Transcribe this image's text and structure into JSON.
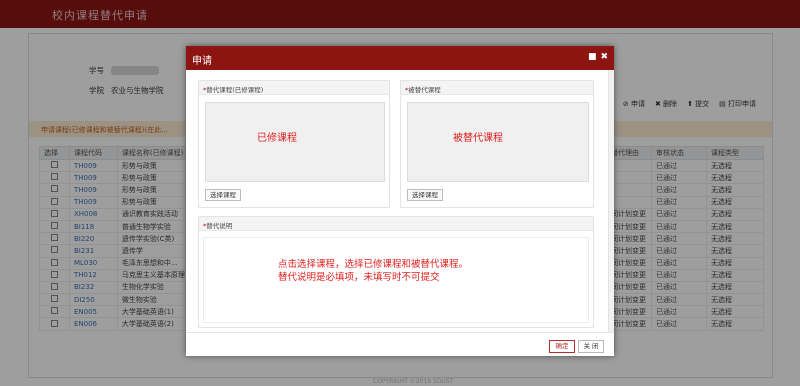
{
  "app": {
    "title": "校内课程替代申请"
  },
  "info": {
    "student_id_label": "学号",
    "college_label": "学院",
    "college_value": "农业与生物学院"
  },
  "toolbar": {
    "apply": "⊘ 申请",
    "delete": "✖ 删除",
    "submit": "⬆ 提交",
    "print": "▤ 打印申请"
  },
  "notice": "申请课程(已修课程和被替代课程)(在此...",
  "table": {
    "headers": [
      "选择",
      "课程代码",
      "课程名称(已修课程)",
      "",
      "",
      "",
      "",
      "替代理由",
      "审核状态",
      "课程类型"
    ],
    "rows": [
      {
        "code": "TH009",
        "name": "形势与政策",
        "reason": "",
        "status": "已通过",
        "type": "无选程"
      },
      {
        "code": "TH009",
        "name": "形势与政策",
        "reason": "",
        "status": "已通过",
        "type": "无选程"
      },
      {
        "code": "TH009",
        "name": "形势与政策",
        "reason": "",
        "status": "已通过",
        "type": "无选程"
      },
      {
        "code": "TH009",
        "name": "形势与政策",
        "reason": "",
        "status": "已通过",
        "type": "无选程"
      },
      {
        "code": "XH008",
        "name": "通识教育实践活动",
        "reason": "同计划变更",
        "status": "已通过",
        "type": "无选程"
      },
      {
        "code": "BI118",
        "name": "普通生物学实验",
        "reason": "同计划变更",
        "status": "已通过",
        "type": "无选程"
      },
      {
        "code": "BI220",
        "name": "遗传学实验(C类)",
        "reason": "同计划变更",
        "status": "已通过",
        "type": "无选程"
      },
      {
        "code": "BI231",
        "name": "遗传学",
        "reason": "同计划变更",
        "status": "已通过",
        "type": "无选程"
      },
      {
        "code": "ML030",
        "name": "毛泽东思想和中...",
        "reason": "同计划变更",
        "status": "已通过",
        "type": "无选程"
      },
      {
        "code": "TH012",
        "name": "马克思主义基本原理",
        "reason": "同计划变更",
        "status": "已通过",
        "type": "无选程"
      },
      {
        "code": "BI232",
        "name": "生物化学实验",
        "reason": "同计划变更",
        "status": "已通过",
        "type": "无选程"
      },
      {
        "code": "DI250",
        "name": "微生物实验",
        "reason": "同计划变更",
        "status": "已通过",
        "type": "无选程"
      },
      {
        "code": "EN005",
        "name": "大学基础英语(1)",
        "reason": "同计划变更",
        "status": "已通过",
        "type": "无选程"
      },
      {
        "code": "EN006",
        "name": "大学基础英语(2)",
        "reason": "同计划变更",
        "status": "已通过",
        "type": "无选程"
      }
    ]
  },
  "footer": "COPYRIGHT ©2019 SDUST",
  "modal": {
    "title": "申请",
    "left_panel": {
      "title": "替代课程(已修课程)",
      "placeholder_text": "已修课程",
      "button": "选择课程"
    },
    "right_panel": {
      "title": "被替代课程",
      "placeholder_text": "被替代课程",
      "button": "选择课程"
    },
    "desc_panel": {
      "title": "替代说明"
    },
    "hint_line1": "点击选择课程，选择已修课程和被替代课程。",
    "hint_line2": "替代说明是必填项，未填写时不可提交",
    "ok_button": "确定",
    "close_button": "关 闭"
  }
}
